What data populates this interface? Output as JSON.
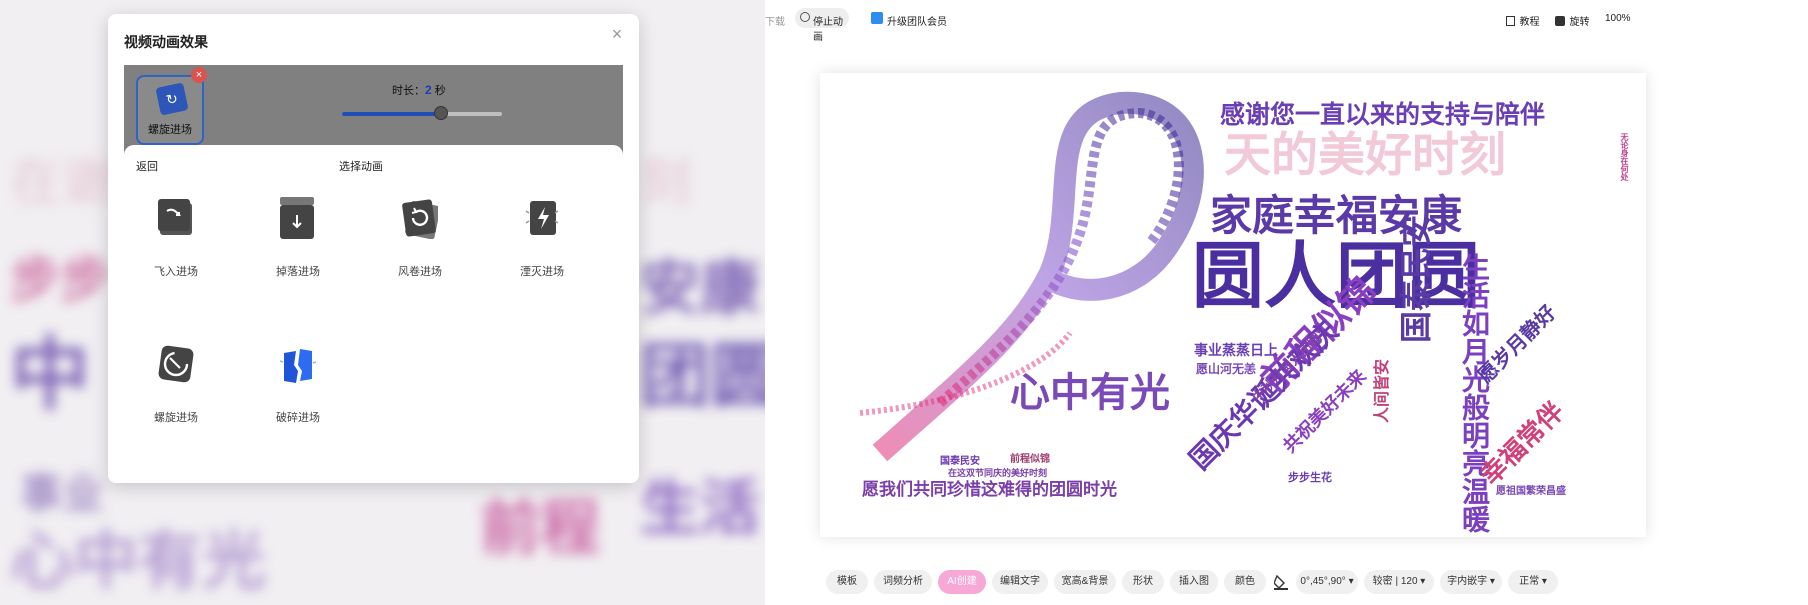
{
  "dialog": {
    "title": "视频动画效果",
    "close_glyph": "×",
    "selected_effect": "螺旋进场",
    "remove_glyph": "×",
    "duration_label": "时长：",
    "duration_value": "2",
    "duration_unit": "秒",
    "duration_level_percent": 62,
    "back_label": "返回",
    "choose_label": "选择动画",
    "animations": [
      {
        "label": "飞入进场",
        "icon": "fly-in-icon"
      },
      {
        "label": "掉落进场",
        "icon": "drop-icon"
      },
      {
        "label": "风卷进场",
        "icon": "whirl-icon"
      },
      {
        "label": "湮灭进场",
        "icon": "annihilate-icon"
      },
      {
        "label": "螺旋进场",
        "icon": "spiral-icon"
      },
      {
        "label": "破碎进场",
        "icon": "shatter-icon"
      }
    ]
  },
  "top_bar": {
    "download": "下载",
    "stop_animation": "停止动画",
    "upgrade": "升级团队会员",
    "tutorial": "教程",
    "rotate": "旋转",
    "zoom": "100%"
  },
  "wordcloud": {
    "words": [
      {
        "text": "感谢您一直以来的支持与陪伴",
        "color": "#6a3fb3"
      },
      {
        "text": "天的美好时刻",
        "color": "#f2c9d6"
      },
      {
        "text": "家庭幸福安康",
        "color": "#5b3aa8"
      },
      {
        "text": "圆人团圆",
        "color": "#4b2fa0"
      },
      {
        "text": "生活如月光般明亮温暖",
        "color": "#7b3fbf"
      },
      {
        "text": "前程似锦",
        "color": "#8a3fc0"
      },
      {
        "text": "国泰民安",
        "color": "#5a3aa3"
      },
      {
        "text": "国庆华诞共欢庆",
        "color": "#6a38b0"
      },
      {
        "text": "幸福常伴",
        "color": "#d0407a"
      },
      {
        "text": "心中有光",
        "color": "#7a4ab8"
      },
      {
        "text": "愿岁月静好",
        "color": "#5a3aa3"
      },
      {
        "text": "愿我们共同珍惜这难得的团圆时光",
        "color": "#7a3fa8"
      },
      {
        "text": "共祝美好未来",
        "color": "#8a3fc0"
      },
      {
        "text": "事业蒸蒸日上",
        "color": "#6a3fb3"
      },
      {
        "text": "中秋月圆人团圆",
        "color": "#8040b0"
      },
      {
        "text": "步步生花",
        "color": "#6a3fb3"
      },
      {
        "text": "人间皆安",
        "color": "#c0407a"
      },
      {
        "text": "愿山河无恙",
        "color": "#7a4ab8"
      },
      {
        "text": "前程似锦",
        "color": "#a04070"
      },
      {
        "text": "国泰民安",
        "color": "#6a38b0"
      },
      {
        "text": "愿祖国繁荣昌盛",
        "color": "#7a4ab8"
      },
      {
        "text": "无论身在何处",
        "color": "#c04090"
      },
      {
        "text": "在这双节同庆的美好时刻",
        "color": "#7a3fa8"
      }
    ]
  },
  "bottom_bar": {
    "buttons": [
      "模板",
      "词频分析",
      "AI创建",
      "编辑文字",
      "宽高&背景",
      "形状",
      "插入图",
      "颜色",
      "0°,45°,90°",
      "较密 | 120",
      "字内嵌字",
      "正常"
    ]
  }
}
